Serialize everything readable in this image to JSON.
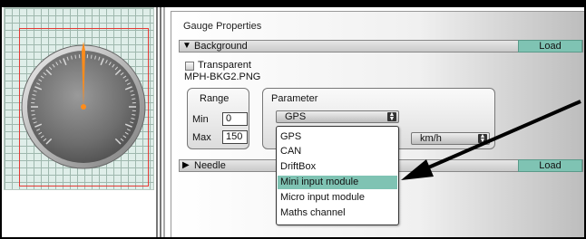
{
  "properties": {
    "title": "Gauge Properties",
    "background": {
      "header": "Background",
      "load_label": "Load",
      "transparent_label": "Transparent",
      "file_name": "MPH-BKG2.PNG",
      "range": {
        "title": "Range",
        "min_label": "Min",
        "min_value": "0",
        "max_label": "Max",
        "max_value": "150"
      },
      "parameter": {
        "title": "Parameter",
        "selected": "GPS",
        "unit": "km/h"
      }
    },
    "needle": {
      "header": "Needle",
      "load_label": "Load"
    }
  },
  "dropdown": {
    "items": [
      "GPS",
      "CAN",
      "DriftBox",
      "Mini input module",
      "Micro input module",
      "Maths channel"
    ],
    "highlighted_index": 3
  },
  "icons": {
    "expand": "triangle-down-icon",
    "collapsed": "triangle-right-icon",
    "select": "chevron-updown-icon",
    "gauge": "speedometer-gauge",
    "annotation": "arrow-annotation"
  },
  "colors": {
    "accent": "#7fc3b3",
    "needle": "#ff8c1a",
    "gauge_face": "#7a7a7a",
    "frame_border": "#e53935"
  }
}
